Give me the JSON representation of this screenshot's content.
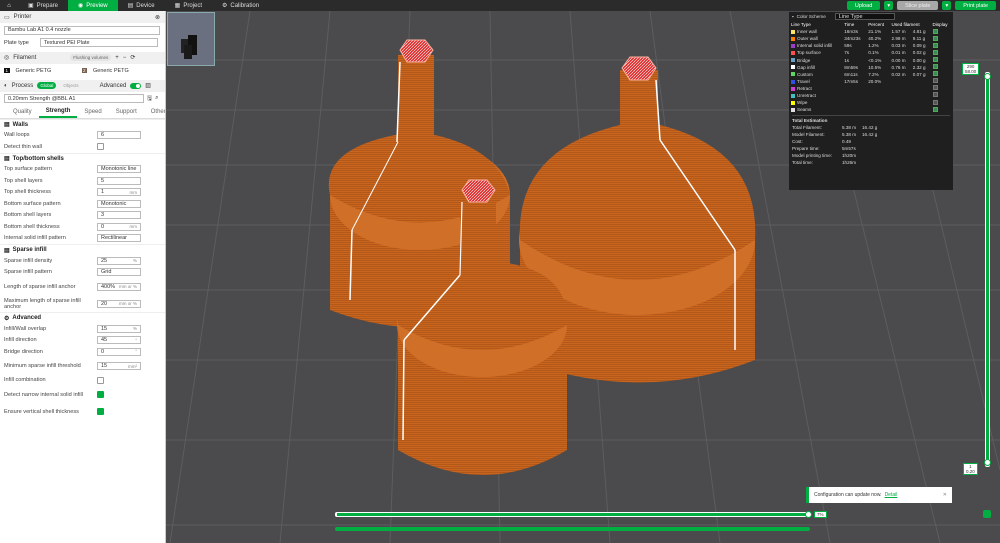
{
  "topbar": {
    "tabs": [
      {
        "label": "Prepare",
        "active": false
      },
      {
        "label": "Preview",
        "active": true
      },
      {
        "label": "Device",
        "active": false
      },
      {
        "label": "Project",
        "active": false
      },
      {
        "label": "Calibration",
        "active": false
      }
    ],
    "upload": "Upload",
    "slice_plate": "Slice plate",
    "print_plate": "Print plate"
  },
  "printer": {
    "title": "Printer",
    "name": "Bambu Lab A1 0.4 nozzle",
    "plate_type_label": "Plate type",
    "plate_type": "Textured PEI Plate"
  },
  "filament": {
    "title": "Filament",
    "flushing": "Flushing volumes",
    "slots": [
      {
        "num": "1",
        "name": "Generic PETG"
      },
      {
        "num": "2",
        "name": "Generic PETG"
      }
    ]
  },
  "process": {
    "title": "Process",
    "global": "Global",
    "objects": "Objects",
    "advanced": "Advanced",
    "preset": "0.20mm Strength @BBL A1",
    "tabs": [
      "Quality",
      "Strength",
      "Speed",
      "Support",
      "Others"
    ],
    "active_tab": "Strength"
  },
  "groups": {
    "walls": {
      "title": "Walls",
      "wall_loops": {
        "label": "Wall loops",
        "value": "6"
      },
      "detect_thin": {
        "label": "Detect thin wall"
      }
    },
    "topbottom": {
      "title": "Top/bottom shells",
      "top_pattern": {
        "label": "Top surface pattern",
        "value": "Monotonic line"
      },
      "top_layers": {
        "label": "Top shell layers",
        "value": "5"
      },
      "top_thickness": {
        "label": "Top shell thickness",
        "value": "1",
        "unit": "mm"
      },
      "bottom_pattern": {
        "label": "Bottom surface pattern",
        "value": "Monotonic"
      },
      "bottom_layers": {
        "label": "Bottom shell layers",
        "value": "3"
      },
      "bottom_thickness": {
        "label": "Bottom shell thickness",
        "value": "0",
        "unit": "mm"
      },
      "internal_pattern": {
        "label": "Internal solid infill pattern",
        "value": "Rectilinear"
      }
    },
    "sparse": {
      "title": "Sparse infill",
      "density": {
        "label": "Sparse infill density",
        "value": "25",
        "unit": "%"
      },
      "pattern": {
        "label": "Sparse infill pattern",
        "value": "Grid"
      },
      "length_anchor": {
        "label": "Length of sparse infill anchor",
        "value": "400%",
        "unit": "mm or %"
      },
      "max_anchor": {
        "label": "Maximum length of sparse infill anchor",
        "value": "20",
        "unit": "mm or %"
      }
    },
    "advanced": {
      "title": "Advanced",
      "overlap": {
        "label": "Infill/Wall overlap",
        "value": "15",
        "unit": "%"
      },
      "direction": {
        "label": "Infill direction",
        "value": "45",
        "unit": "°"
      },
      "bridge": {
        "label": "Bridge direction",
        "value": "0",
        "unit": "°"
      },
      "min_sparse": {
        "label": "Minimum sparse infill threshold",
        "value": "15",
        "unit": "mm²"
      },
      "combination": {
        "label": "Infill combination"
      },
      "narrow": {
        "label": "Detect narrow internal solid infill"
      },
      "vertical": {
        "label": "Ensure vertical shell thickness"
      }
    }
  },
  "legend": {
    "title": "Color Scheme",
    "scheme": "Line Type",
    "headers": [
      "Line Type",
      "Time",
      "Percent",
      "Used filament",
      "Display"
    ],
    "rows": [
      {
        "name": "Inner wall",
        "color": "#ffe566",
        "time": "16m3s",
        "pct": "21.1%",
        "m": "1.57 m",
        "g": "4.81 g"
      },
      {
        "name": "Outer wall",
        "color": "#ff7f00",
        "time": "34m23s",
        "pct": "40.2%",
        "m": "2.98 m",
        "g": "9.11 g"
      },
      {
        "name": "Internal solid infill",
        "color": "#9b3cc9",
        "time": "59s",
        "pct": "1.2%",
        "m": "0.03 m",
        "g": "0.09 g"
      },
      {
        "name": "Top surface",
        "color": "#ff5050",
        "time": "7s",
        "pct": "0.1%",
        "m": "0.01 m",
        "g": "0.02 g"
      },
      {
        "name": "Bridge",
        "color": "#6aa0c8",
        "time": "1s",
        "pct": "<0.1%",
        "m": "0.00 m",
        "g": "0.00 g"
      },
      {
        "name": "Gap infill",
        "color": "#ffffff",
        "time": "8m59s",
        "pct": "10.5%",
        "m": "0.76 m",
        "g": "2.32 g"
      },
      {
        "name": "Custom",
        "color": "#5fd65f",
        "time": "6m11s",
        "pct": "7.2%",
        "m": "0.02 m",
        "g": "0.07 g"
      },
      {
        "name": "Travel",
        "color": "#3050e0",
        "time": "17m5s",
        "pct": "20.0%",
        "m": "",
        "g": ""
      },
      {
        "name": "Retract",
        "color": "#d040d0",
        "time": "",
        "pct": "",
        "m": "",
        "g": ""
      },
      {
        "name": "Unretract",
        "color": "#40c0c0",
        "time": "",
        "pct": "",
        "m": "",
        "g": ""
      },
      {
        "name": "Wipe",
        "color": "#ffff00",
        "time": "",
        "pct": "",
        "m": "",
        "g": ""
      },
      {
        "name": "Seams",
        "color": "#e0e0e0",
        "time": "",
        "pct": "",
        "m": "",
        "g": ""
      }
    ],
    "est_title": "Total Estimation",
    "est": [
      {
        "k": "Total Filament:",
        "v1": "5.38 m",
        "v2": "16.42 g"
      },
      {
        "k": "Model Filament:",
        "v1": "5.38 m",
        "v2": "16.42 g"
      },
      {
        "k": "Cost:",
        "v1": "0.49",
        "v2": ""
      },
      {
        "k": "Prepare time:",
        "v1": "5m57s",
        "v2": ""
      },
      {
        "k": "Model printing time:",
        "v1": "1h20m",
        "v2": ""
      },
      {
        "k": "Total time:",
        "v1": "1h26m",
        "v2": ""
      }
    ]
  },
  "sliders": {
    "top_layer": "290",
    "top_height": "58.00",
    "bottom_layer": "1",
    "bottom_height": "0.20",
    "h_value": "7%"
  },
  "notification": {
    "text": "Configuration can update now.",
    "link": "Detail"
  }
}
